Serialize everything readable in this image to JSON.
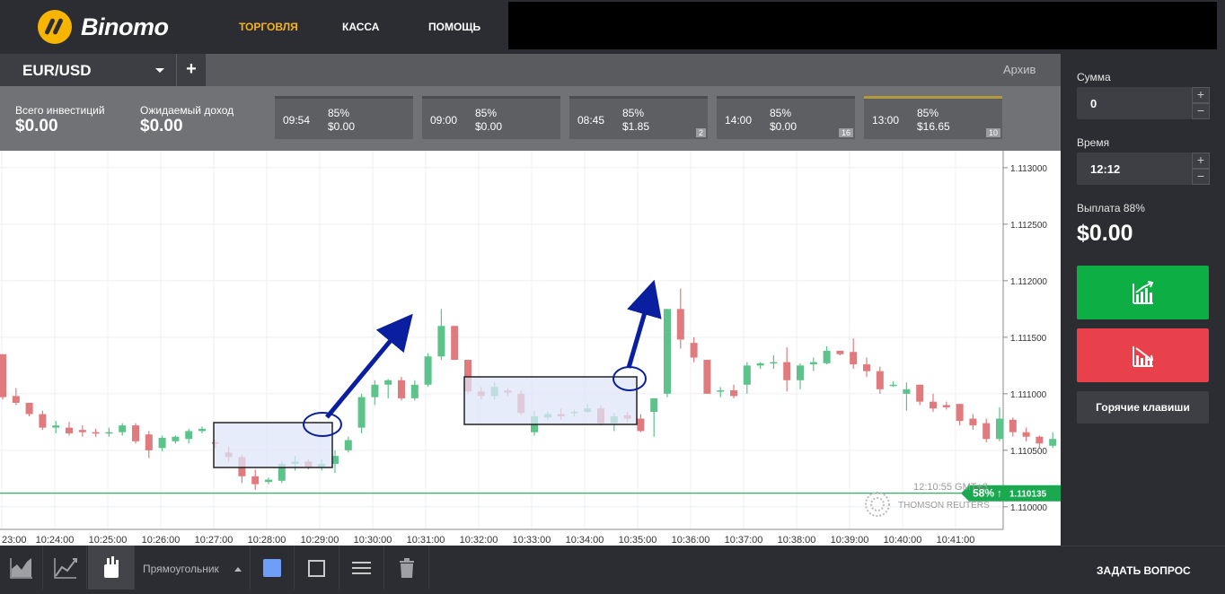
{
  "header": {
    "brand": "Binomo",
    "nav": [
      "ТОРГОВЛЯ",
      "КАССА",
      "ПОМОЩЬ"
    ],
    "active_nav": "ТОРГОВЛЯ"
  },
  "tabs": {
    "pair": "EUR/USD",
    "add": "+",
    "archive": "Архив"
  },
  "info": {
    "total_label": "Всего инвестиций",
    "total_value": "$0.00",
    "expected_label": "Ожидаемый доход",
    "expected_value": "$0.00"
  },
  "deals": [
    {
      "time": "09:54",
      "pct": "85%",
      "amount": "$0.00",
      "badge": ""
    },
    {
      "time": "09:00",
      "pct": "85%",
      "amount": "$0.00",
      "badge": ""
    },
    {
      "time": "08:45",
      "pct": "85%",
      "amount": "$1.85",
      "badge": "2"
    },
    {
      "time": "14:00",
      "pct": "85%",
      "amount": "$0.00",
      "badge": "16"
    },
    {
      "time": "13:00",
      "pct": "85%",
      "amount": "$16.65",
      "badge": "10"
    }
  ],
  "chart_data": {
    "type": "candlestick",
    "x_ticks": [
      "23:00",
      "10:24:00",
      "10:25:00",
      "10:26:00",
      "10:27:00",
      "10:28:00",
      "10:29:00",
      "10:30:00",
      "10:31:00",
      "10:32:00",
      "10:33:00",
      "10:34:00",
      "10:35:00",
      "10:36:00",
      "10:37:00",
      "10:38:00",
      "10:39:00",
      "10:40:00",
      "10:41:00"
    ],
    "y_ticks": [
      "1.113000",
      "1.112500",
      "1.112000",
      "1.111500",
      "1.111000",
      "1.110500",
      "1.110000"
    ],
    "ylim": [
      1.1098,
      1.11315
    ],
    "price_line": 1.11012,
    "price_badge_pct": "58%",
    "price_badge_arrow": "↑",
    "price_badge_value": "1.110135",
    "timestamp": "12:10:55 GMT+3",
    "provider": "THOMSON REUTERS",
    "candles": [
      [
        1.11135,
        1.11135,
        1.11095,
        1.11097
      ],
      [
        1.11098,
        1.11105,
        1.1109,
        1.11092
      ],
      [
        1.11092,
        1.11092,
        1.1108,
        1.11082
      ],
      [
        1.11082,
        1.11085,
        1.11068,
        1.1107
      ],
      [
        1.1107,
        1.11076,
        1.11065,
        1.11072
      ],
      [
        1.1107,
        1.11075,
        1.11063,
        1.11065
      ],
      [
        1.11068,
        1.11072,
        1.11062,
        1.11066
      ],
      [
        1.11066,
        1.11069,
        1.11062,
        1.11065
      ],
      [
        1.11065,
        1.1107,
        1.11062,
        1.11066
      ],
      [
        1.11066,
        1.11074,
        1.11063,
        1.11072
      ],
      [
        1.11072,
        1.11074,
        1.11056,
        1.11058
      ],
      [
        1.11064,
        1.11067,
        1.11043,
        1.1105
      ],
      [
        1.11052,
        1.11063,
        1.11049,
        1.11061
      ],
      [
        1.11058,
        1.11063,
        1.11056,
        1.11062
      ],
      [
        1.1106,
        1.11069,
        1.11056,
        1.11067
      ],
      [
        1.11067,
        1.11071,
        1.11065,
        1.11069
      ],
      [
        1.11057,
        1.11059,
        1.11052,
        1.11056
      ],
      [
        1.11048,
        1.11053,
        1.1104,
        1.11044
      ],
      [
        1.11044,
        1.11046,
        1.11021,
        1.11027
      ],
      [
        1.11027,
        1.11033,
        1.11015,
        1.1102
      ],
      [
        1.11022,
        1.11026,
        1.1102,
        1.11024
      ],
      [
        1.11023,
        1.1104,
        1.11021,
        1.11038
      ],
      [
        1.11038,
        1.11045,
        1.11032,
        1.1104
      ],
      [
        1.1104,
        1.11042,
        1.11033,
        1.11035
      ],
      [
        1.11035,
        1.11042,
        1.11032,
        1.11038
      ],
      [
        1.11038,
        1.1105,
        1.1103,
        1.11045
      ],
      [
        1.1105,
        1.11062,
        1.11048,
        1.11059
      ],
      [
        1.1107,
        1.111,
        1.11065,
        1.11097
      ],
      [
        1.11097,
        1.11112,
        1.1109,
        1.11108
      ],
      [
        1.11108,
        1.11113,
        1.11096,
        1.11112
      ],
      [
        1.11112,
        1.11115,
        1.11094,
        1.11096
      ],
      [
        1.11096,
        1.11112,
        1.11094,
        1.11108
      ],
      [
        1.11108,
        1.11136,
        1.11106,
        1.11133
      ],
      [
        1.11133,
        1.11175,
        1.1113,
        1.1116
      ],
      [
        1.1116,
        1.1116,
        1.1113,
        1.1113
      ],
      [
        1.1113,
        1.1113,
        1.111,
        1.11102
      ],
      [
        1.11102,
        1.11106,
        1.11095,
        1.11098
      ],
      [
        1.11098,
        1.1111,
        1.11095,
        1.11106
      ],
      [
        1.11103,
        1.11105,
        1.11098,
        1.11101
      ],
      [
        1.111,
        1.11103,
        1.11081,
        1.11083
      ],
      [
        1.11066,
        1.11085,
        1.11063,
        1.1108
      ],
      [
        1.11079,
        1.11084,
        1.11077,
        1.11082
      ],
      [
        1.11082,
        1.11087,
        1.11077,
        1.1108
      ],
      [
        1.11083,
        1.11086,
        1.1108,
        1.11084
      ],
      [
        1.11084,
        1.11091,
        1.11083,
        1.11087
      ],
      [
        1.11087,
        1.1109,
        1.11072,
        1.11074
      ],
      [
        1.11074,
        1.11083,
        1.11067,
        1.1108
      ],
      [
        1.11081,
        1.11084,
        1.11075,
        1.11078
      ],
      [
        1.11078,
        1.11082,
        1.11066,
        1.11067
      ],
      [
        1.11084,
        1.11096,
        1.11062,
        1.11096
      ],
      [
        1.111,
        1.11175,
        1.11097,
        1.11175
      ],
      [
        1.11175,
        1.11193,
        1.1114,
        1.11148
      ],
      [
        1.11145,
        1.1115,
        1.11128,
        1.11132
      ],
      [
        1.1113,
        1.1113,
        1.111,
        1.111
      ],
      [
        1.11102,
        1.11106,
        1.11097,
        1.11103
      ],
      [
        1.11103,
        1.11108,
        1.11096,
        1.11098
      ],
      [
        1.11108,
        1.11128,
        1.111,
        1.11125
      ],
      [
        1.11125,
        1.11128,
        1.11122,
        1.11127
      ],
      [
        1.11127,
        1.11134,
        1.11122,
        1.11128
      ],
      [
        1.11128,
        1.11141,
        1.11102,
        1.11112
      ],
      [
        1.11112,
        1.11127,
        1.11104,
        1.11125
      ],
      [
        1.11126,
        1.11132,
        1.1112,
        1.11128
      ],
      [
        1.11127,
        1.11142,
        1.11126,
        1.11138
      ],
      [
        1.11138,
        1.11138,
        1.11134,
        1.11135
      ],
      [
        1.11137,
        1.11149,
        1.11122,
        1.11126
      ],
      [
        1.11126,
        1.11132,
        1.11115,
        1.1112
      ],
      [
        1.1112,
        1.11124,
        1.111,
        1.11104
      ],
      [
        1.11108,
        1.11111,
        1.11106,
        1.11108
      ],
      [
        1.111,
        1.1111,
        1.11085,
        1.11104
      ],
      [
        1.11108,
        1.11108,
        1.1109,
        1.11093
      ],
      [
        1.11093,
        1.111,
        1.11084,
        1.11087
      ],
      [
        1.1109,
        1.11093,
        1.11086,
        1.11088
      ],
      [
        1.11091,
        1.11091,
        1.11072,
        1.11076
      ],
      [
        1.11078,
        1.11082,
        1.11068,
        1.11072
      ],
      [
        1.11074,
        1.11078,
        1.11057,
        1.1106
      ],
      [
        1.1106,
        1.11088,
        1.11058,
        1.11078
      ],
      [
        1.11077,
        1.11079,
        1.11062,
        1.11066
      ],
      [
        1.11066,
        1.1107,
        1.11058,
        1.11062
      ],
      [
        1.11062,
        1.11063,
        1.11052,
        1.11056
      ],
      [
        1.11054,
        1.11066,
        1.11052,
        1.1106
      ]
    ]
  },
  "toolbar": {
    "shape_label": "Прямоугольник"
  },
  "sidebar": {
    "amount_label": "Сумма",
    "amount_value": "0",
    "time_label": "Время",
    "time_value": "12:12",
    "payout_label": "Выплата 88%",
    "payout_value": "$0.00",
    "hotkeys": "Горячие клавиши",
    "ask": "ЗАДАТЬ ВОПРОС",
    "up_color": "#0dae43",
    "down_color": "#e8414b"
  }
}
